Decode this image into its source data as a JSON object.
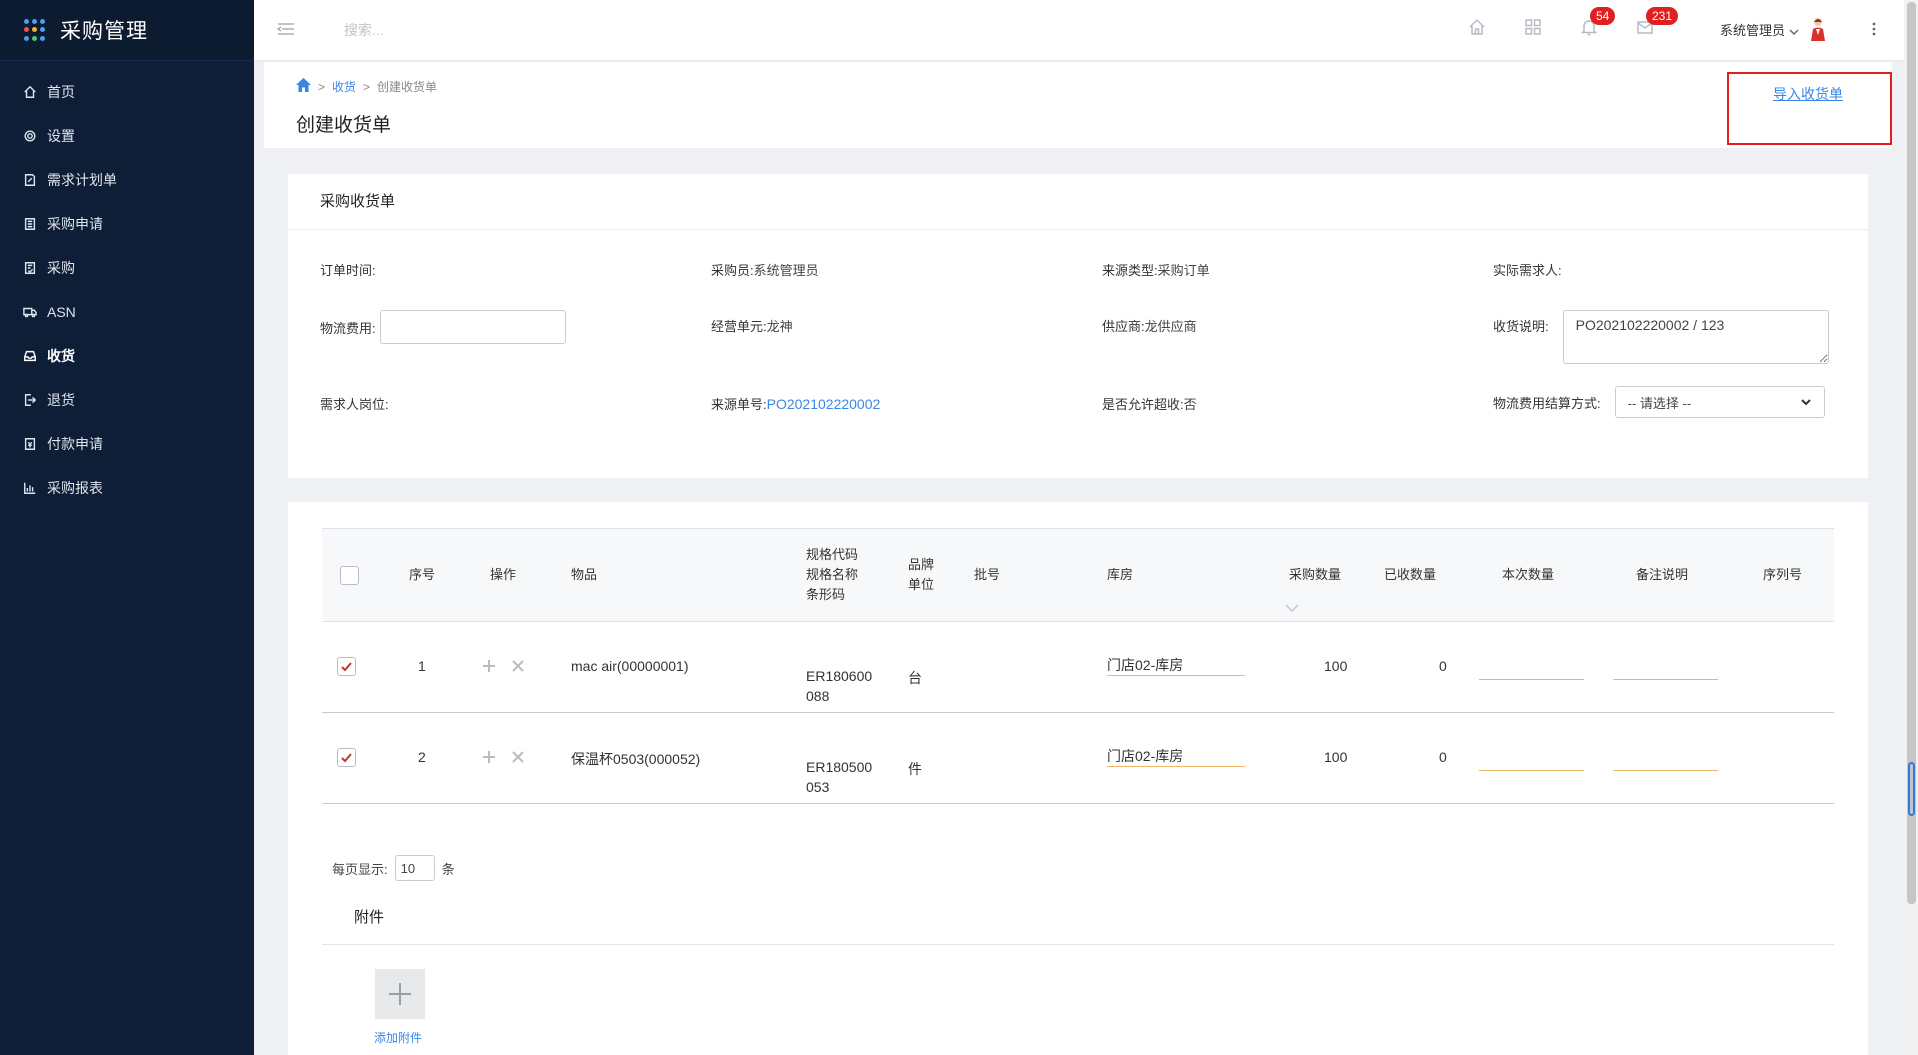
{
  "sidebar": {
    "brand": "采购管理",
    "items": [
      {
        "label": "首页",
        "icon": "home-icon"
      },
      {
        "label": "设置",
        "icon": "gear-icon"
      },
      {
        "label": "需求计划单",
        "icon": "document-edit-icon"
      },
      {
        "label": "采购申请",
        "icon": "document-list-icon"
      },
      {
        "label": "采购",
        "icon": "document-check-icon"
      },
      {
        "label": "ASN",
        "icon": "truck-icon"
      },
      {
        "label": "收货",
        "icon": "inbox-icon"
      },
      {
        "label": "退货",
        "icon": "exit-icon"
      },
      {
        "label": "付款申请",
        "icon": "payment-icon"
      },
      {
        "label": "采购报表",
        "icon": "bar-chart-icon"
      }
    ]
  },
  "topbar": {
    "search_placeholder": "搜索...",
    "notifications_count": "54",
    "messages_count": "231",
    "user_name": "系统管理员"
  },
  "header": {
    "breadcrumb_link": "收货",
    "breadcrumb_current": "创建收货单",
    "title": "创建收货单",
    "import_label": "导入收货单"
  },
  "form": {
    "title": "采购收货单",
    "order_time_label": "订单时间:",
    "buyer_label": "采购员:",
    "buyer_value": "系统管理员",
    "source_type_label": "来源类型:",
    "source_type_value": "采购订单",
    "actual_requester_label": "实际需求人:",
    "logistics_fee_label": "物流费用:",
    "business_unit_label": "经营单元:",
    "business_unit_value": "龙神",
    "supplier_label": "供应商:",
    "supplier_value": "龙供应商",
    "receipt_note_label": "收货说明:",
    "receipt_note_value": "PO202102220002 / 123",
    "requester_post_label": "需求人岗位:",
    "source_no_label": "来源单号:",
    "source_no_value": "PO202102220002",
    "allow_over_label": "是否允许超收:",
    "allow_over_value": "否",
    "settlement_label": "物流费用结算方式:",
    "settlement_selected": "-- 请选择 --"
  },
  "table": {
    "headers": {
      "seq": "序号",
      "ops": "操作",
      "item": "物品",
      "spec_code": "规格代码",
      "spec_name": "规格名称",
      "barcode": "条形码",
      "brand": "品牌",
      "unit": "单位",
      "batch": "批号",
      "warehouse": "库房",
      "purchase_qty": "采购数量",
      "received_qty": "已收数量",
      "current_qty": "本次数量",
      "remark": "备注说明",
      "serial": "序列号"
    },
    "rows": [
      {
        "seq": "1",
        "item": "mac air(00000001)",
        "spec_code_1": "ER180600",
        "spec_code_2": "088",
        "unit": "台",
        "warehouse": "门店02-库房",
        "purchase_qty": "100",
        "received_qty": "0"
      },
      {
        "seq": "2",
        "item": "保温杯0503(000052)",
        "spec_code_1": "ER180500",
        "spec_code_2": "053",
        "unit": "件",
        "warehouse": "门店02-库房",
        "purchase_qty": "100",
        "received_qty": "0"
      }
    ]
  },
  "pager": {
    "label": "每页显示:",
    "size": "10",
    "suffix": "条"
  },
  "attachments": {
    "title": "附件",
    "add_label": "添加附件"
  },
  "colors": {
    "sidebar_bg": "#0e1e37",
    "link": "#3a86e6",
    "badge": "#e02020",
    "highlight": "#e02020"
  }
}
